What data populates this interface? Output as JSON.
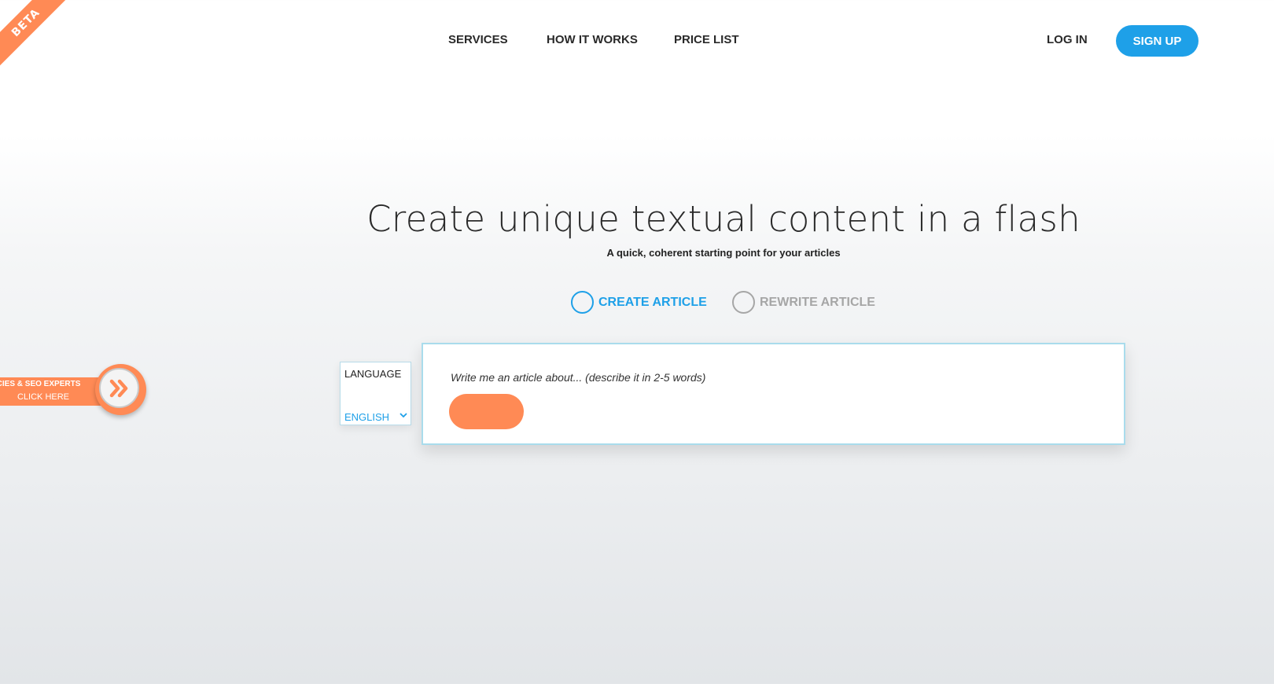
{
  "badge": {
    "label": "BETA"
  },
  "nav": {
    "services": "SERVICES",
    "how_it_works": "HOW IT WORKS",
    "price_list": "PRICE LIST",
    "login": "LOG IN",
    "signup": "SIGN UP"
  },
  "hero": {
    "title": "Create unique textual content in a flash",
    "subtitle": "A quick, coherent starting point for your articles"
  },
  "modes": [
    {
      "label": "CREATE ARTICLE",
      "color": "#1ea0e8"
    },
    {
      "label": "REWRITE ARTICLE",
      "color": "#a6a6a6"
    }
  ],
  "language": {
    "label": "LANGUAGE",
    "selected": "ENGLISH"
  },
  "article_form": {
    "placeholder": "Write me an article about... (describe it in 2-5 words)"
  },
  "side_promo": {
    "line1": "GENCIES & SEO EXPERTS",
    "line2": "CLICK HERE"
  },
  "colors": {
    "accent": "#1ea0e8",
    "orange": "#ff8a55"
  }
}
